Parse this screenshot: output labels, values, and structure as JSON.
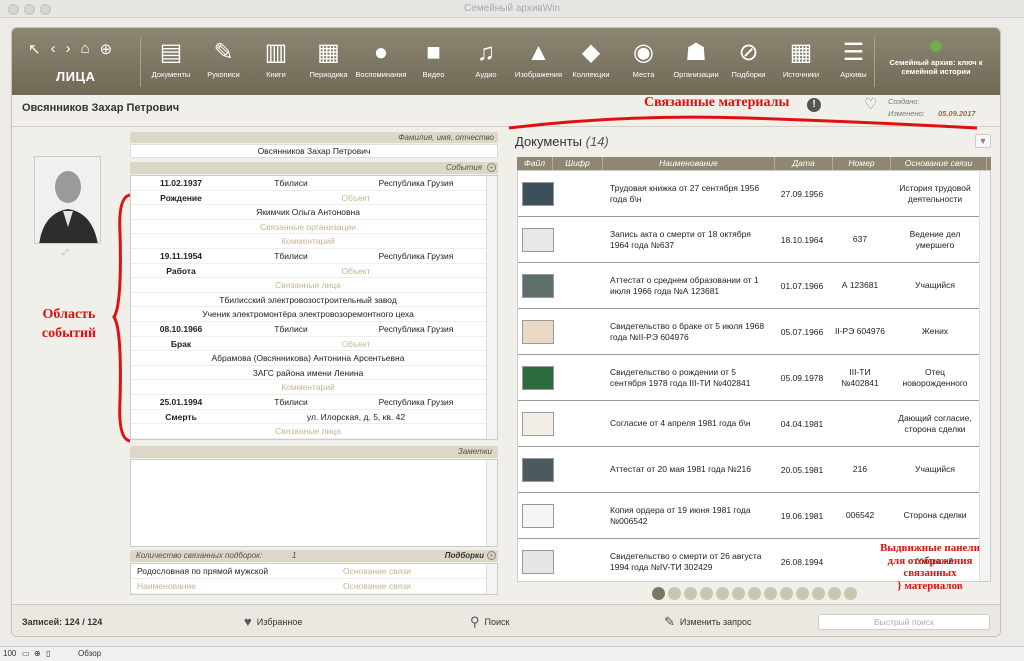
{
  "window": {
    "title": "Семейный архивWin"
  },
  "nav": {
    "section": "ЛИЦА"
  },
  "toolbar": [
    {
      "label": "Документы",
      "icon": "documents-icon",
      "glyph": "▤"
    },
    {
      "label": "Рукописи",
      "icon": "manuscripts-icon",
      "glyph": "✎"
    },
    {
      "label": "Книги",
      "icon": "books-icon",
      "glyph": "▥"
    },
    {
      "label": "Периодика",
      "icon": "periodicals-icon",
      "glyph": "▦"
    },
    {
      "label": "Воспоминания",
      "icon": "memories-icon",
      "glyph": "●"
    },
    {
      "label": "Видео",
      "icon": "video-icon",
      "glyph": "■"
    },
    {
      "label": "Аудио",
      "icon": "audio-icon",
      "glyph": "♫"
    },
    {
      "label": "Изображения",
      "icon": "images-icon",
      "glyph": "▲"
    },
    {
      "label": "Коллекции",
      "icon": "collections-icon",
      "glyph": "◆"
    },
    {
      "label": "Места",
      "icon": "places-icon",
      "glyph": "◉"
    },
    {
      "label": "Организации",
      "icon": "organizations-icon",
      "glyph": "☗"
    },
    {
      "label": "Подборки",
      "icon": "selections-icon",
      "glyph": "⊘"
    },
    {
      "label": "Источники",
      "icon": "sources-icon",
      "glyph": "▦"
    },
    {
      "label": "Архивы",
      "icon": "archives-icon",
      "glyph": "☰"
    }
  ],
  "brand": {
    "line1": "Семейный архив: ключ к",
    "line2": "семейной истории"
  },
  "person": {
    "name": "Овсянников Захар Петрович",
    "created_label": "Создано:",
    "modified_label": "Изменено:",
    "modified_value": "05.09.2017"
  },
  "annotations": {
    "related": "Связанные материалы",
    "events_line1": "Область",
    "events_line2": "событий",
    "panels_line1": "Выдвижные панели",
    "panels_line2": "для отображения",
    "panels_line3": "связанных",
    "panels_line4": "} материалов"
  },
  "fio": {
    "header": "Фамилия, имя, отчество",
    "value": "Овсянников Захар Петрович"
  },
  "events": {
    "header": "События",
    "items": [
      {
        "date": "11.02.1937",
        "city": "Тбилиси",
        "country": "Республика Грузия",
        "type": "Рождение",
        "object": "Объект",
        "lines": [
          {
            "text": "Якимчик Ольга Антоновна",
            "ph": false
          },
          {
            "text": "Связанные организации",
            "ph": true
          },
          {
            "text": "Комментарий",
            "ph": true
          }
        ]
      },
      {
        "date": "19.11.1954",
        "city": "Тбилиси",
        "country": "Республика Грузия",
        "type": "Работа",
        "object": "Объект",
        "lines": [
          {
            "text": "Связанные лица",
            "ph": true
          },
          {
            "text": "Тбилисский электровозостроительный завод",
            "ph": false
          },
          {
            "text": "Ученик электромонтёра электровозоремонтного цеха",
            "ph": false
          }
        ]
      },
      {
        "date": "08.10.1966",
        "city": "Тбилиси",
        "country": "Республика Грузия",
        "type": "Брак",
        "object": "Объект",
        "lines": [
          {
            "text": "Абрамова (Овсянникова) Антонина Арсентьевна",
            "ph": false
          },
          {
            "text": "ЗАГС района имени Ленина",
            "ph": false
          },
          {
            "text": "Комментарий",
            "ph": true
          }
        ]
      },
      {
        "date": "25.01.1994",
        "city": "Тбилиси",
        "country": "Республика Грузия",
        "type": "Смерть",
        "object": "ул. Илорская, д. 5, кв. 42",
        "lines": [
          {
            "text": "Связанные лица",
            "ph": true
          }
        ]
      }
    ]
  },
  "notes": {
    "header": "Заметки"
  },
  "selections": {
    "count_label": "Количество связанных подборок:",
    "count_value": "1",
    "header": "Подборки",
    "rows": [
      {
        "name": "Родословная по прямой мужской",
        "basis": "Основание связи"
      },
      {
        "name": "Наименование",
        "basis": "Основание связи",
        "ph": true
      }
    ]
  },
  "documents": {
    "title": "Документы",
    "count": "(14)",
    "columns": [
      "Файл",
      "Шифр",
      "Наименование",
      "Дата",
      "Номер",
      "Основание связи"
    ],
    "rows": [
      {
        "name": "Трудовая книжка от 27 сентября 1956 года б\\н",
        "date": "27.09.1956",
        "number": "",
        "basis": "История трудовой деятельности",
        "thumb": "#3d4f5a"
      },
      {
        "name": "Запись акта о смерти от 18 октября 1964 года №637",
        "date": "18.10.1964",
        "number": "637",
        "basis": "Ведение дел умершего",
        "thumb": "#e8e8e8"
      },
      {
        "name": "Аттестат о среднем образовании от 1 июля 1966 года №А 123681",
        "date": "01.07.1966",
        "number": "А 123681",
        "basis": "Учащийся",
        "thumb": "#5e6f6c"
      },
      {
        "name": "Свидетельство о браке от 5 июля 1968 года №II-РЭ 604976",
        "date": "05.07.1966",
        "number": "II-РЭ 604976",
        "basis": "Жених",
        "thumb": "#e9d9c4"
      },
      {
        "name": "Свидетельство о рождении от 5 сентября 1978 года III-ТИ №402841",
        "date": "05.09.1978",
        "number": "III-ТИ №402841",
        "basis": "Отец новорожденного",
        "thumb": "#2c6b3e"
      },
      {
        "name": "Согласие от 4 апреля 1981 года б\\н",
        "date": "04.04.1981",
        "number": "",
        "basis": "Дающий согласие, сторона сделки",
        "thumb": "#f3efe6"
      },
      {
        "name": "Аттестат от 20 мая 1981 года №216",
        "date": "20.05.1981",
        "number": "216",
        "basis": "Учащийся",
        "thumb": "#4a5a5f"
      },
      {
        "name": "Копия ордера от 19 июня 1981 года №006542",
        "date": "19.06.1981",
        "number": "006542",
        "basis": "Сторона сделки",
        "thumb": "#f4f4f4"
      },
      {
        "name": "Свидетельство о смерти от 26 августа 1994 года №IV-ТИ 302429",
        "date": "26.08.1994",
        "number": "",
        "basis": "Умерший",
        "thumb": "#e6e6e6"
      }
    ]
  },
  "pager": {
    "total": 13,
    "active": 0
  },
  "status": {
    "records_label": "Записей:",
    "records_value": "124 / 124",
    "favorites": "Избранное",
    "search": "Поиск",
    "change_query": "Изменить запрос",
    "quick_search_placeholder": "Быстрый поиск"
  },
  "bottom": {
    "zoom": "100",
    "mode": "Обзор"
  }
}
